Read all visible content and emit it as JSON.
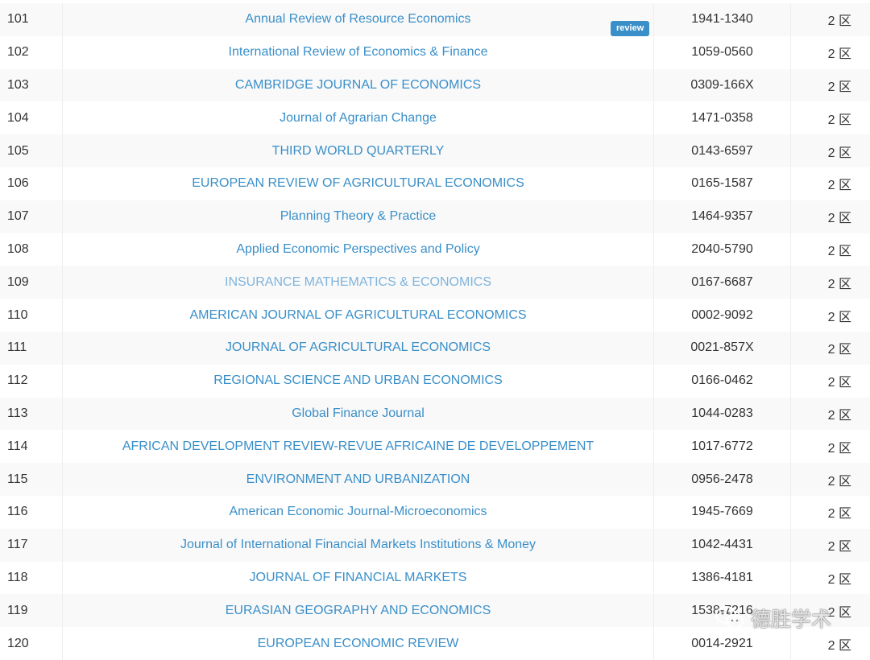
{
  "table": {
    "rows": [
      {
        "rank": "101",
        "name": "Annual Review of Resource Economics",
        "issn": "1941-1340",
        "zone": "2 区",
        "badge": "review"
      },
      {
        "rank": "102",
        "name": "International Review of Economics & Finance",
        "issn": "1059-0560",
        "zone": "2 区"
      },
      {
        "rank": "103",
        "name": "CAMBRIDGE JOURNAL OF ECONOMICS",
        "issn": "0309-166X",
        "zone": "2 区"
      },
      {
        "rank": "104",
        "name": "Journal of Agrarian Change",
        "issn": "1471-0358",
        "zone": "2 区"
      },
      {
        "rank": "105",
        "name": "THIRD WORLD QUARTERLY",
        "issn": "0143-6597",
        "zone": "2 区"
      },
      {
        "rank": "106",
        "name": "EUROPEAN REVIEW OF AGRICULTURAL ECONOMICS",
        "issn": "0165-1587",
        "zone": "2 区"
      },
      {
        "rank": "107",
        "name": "Planning Theory & Practice",
        "issn": "1464-9357",
        "zone": "2 区"
      },
      {
        "rank": "108",
        "name": "Applied Economic Perspectives and Policy",
        "issn": "2040-5790",
        "zone": "2 区"
      },
      {
        "rank": "109",
        "name": "INSURANCE MATHEMATICS & ECONOMICS",
        "issn": "0167-6687",
        "zone": "2 区",
        "visited": true
      },
      {
        "rank": "110",
        "name": "AMERICAN JOURNAL OF AGRICULTURAL ECONOMICS",
        "issn": "0002-9092",
        "zone": "2 区"
      },
      {
        "rank": "111",
        "name": "JOURNAL OF AGRICULTURAL ECONOMICS",
        "issn": "0021-857X",
        "zone": "2 区"
      },
      {
        "rank": "112",
        "name": "REGIONAL SCIENCE AND URBAN ECONOMICS",
        "issn": "0166-0462",
        "zone": "2 区"
      },
      {
        "rank": "113",
        "name": "Global Finance Journal",
        "issn": "1044-0283",
        "zone": "2 区"
      },
      {
        "rank": "114",
        "name": "AFRICAN DEVELOPMENT REVIEW-REVUE AFRICAINE DE DEVELOPPEMENT",
        "issn": "1017-6772",
        "zone": "2 区"
      },
      {
        "rank": "115",
        "name": "ENVIRONMENT AND URBANIZATION",
        "issn": "0956-2478",
        "zone": "2 区"
      },
      {
        "rank": "116",
        "name": "American Economic Journal-Microeconomics",
        "issn": "1945-7669",
        "zone": "2 区"
      },
      {
        "rank": "117",
        "name": "Journal of International Financial Markets Institutions & Money",
        "issn": "1042-4431",
        "zone": "2 区"
      },
      {
        "rank": "118",
        "name": "JOURNAL OF FINANCIAL MARKETS",
        "issn": "1386-4181",
        "zone": "2 区"
      },
      {
        "rank": "119",
        "name": "EURASIAN GEOGRAPHY AND ECONOMICS",
        "issn": "1538-7216",
        "zone": "2 区"
      },
      {
        "rank": "120",
        "name": "EUROPEAN ECONOMIC REVIEW",
        "issn": "0014-2921",
        "zone": "2 区"
      }
    ]
  },
  "watermark": {
    "text": "德胜学术",
    "icon": "wechat-icon"
  },
  "colors": {
    "link": "#3a8fc9",
    "link_visited": "#7fb4dc",
    "badge": "#3a8fc9",
    "stripe": "#f9f9f9"
  }
}
